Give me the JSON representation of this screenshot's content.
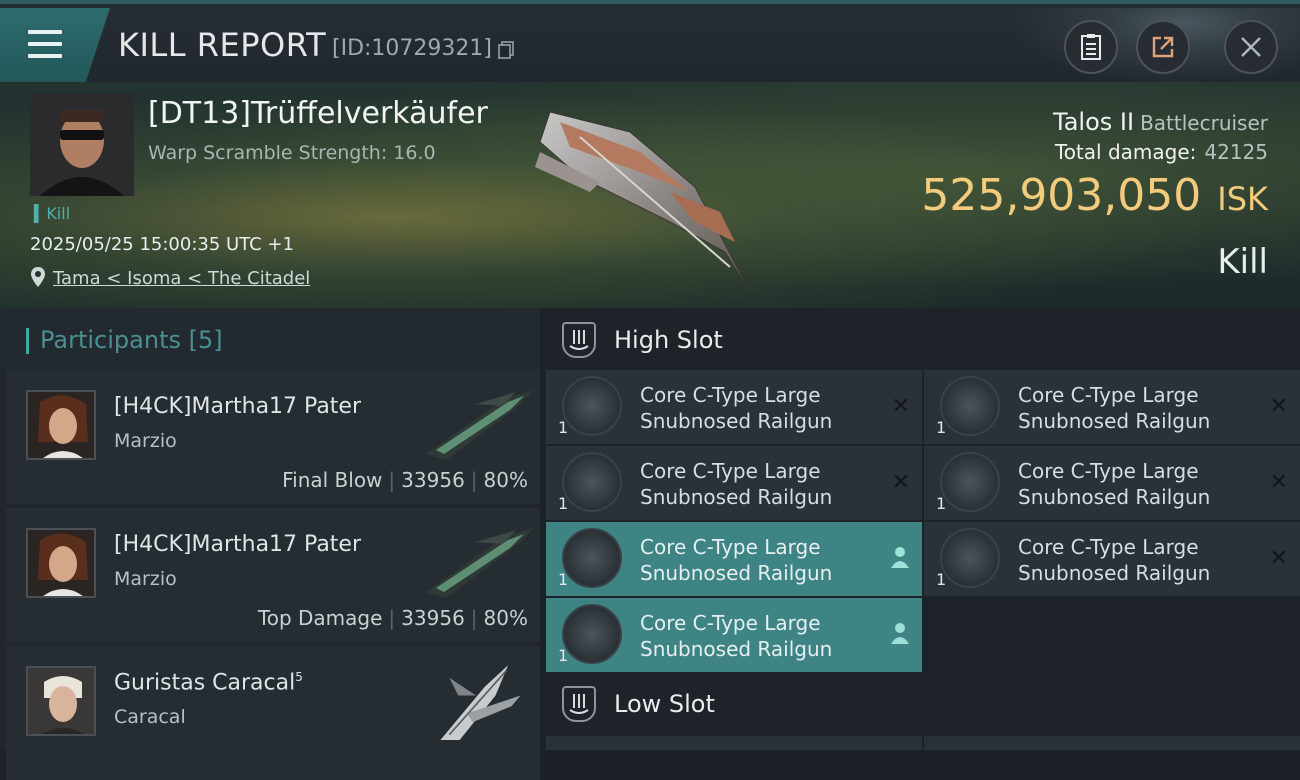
{
  "header": {
    "title": "KILL REPORT",
    "report_id": "[ID:10729321]"
  },
  "victim": {
    "name": "[DT13]Trüffelverkäufer",
    "sub_stat": "Warp Scramble Strength: 16.0",
    "tag": "Kill",
    "time": "2025/05/25 15:00:35 UTC +1",
    "location": "Tama < Isoma < The Citadel",
    "ship_name": "Talos II",
    "ship_class": "Battlecruiser",
    "total_damage_label": "Total damage:",
    "total_damage": "42125",
    "isk_value": "525,903,050",
    "isk_unit": "ISK",
    "result": "Kill"
  },
  "participants": {
    "label": "Participants",
    "count": "[5]",
    "items": [
      {
        "name": "[H4CK]Martha17 Pater",
        "sup": "",
        "corp": "Marzio",
        "role": "Final Blow",
        "damage": "33956",
        "percent": "80%"
      },
      {
        "name": "[H4CK]Martha17 Pater",
        "sup": "",
        "corp": "Marzio",
        "role": "Top Damage",
        "damage": "33956",
        "percent": "80%"
      },
      {
        "name": "Guristas Caracal",
        "sup": "5",
        "corp": "Caracal",
        "role": "",
        "damage": "",
        "percent": ""
      }
    ]
  },
  "fitting": {
    "high_slot_label": "High Slot",
    "low_slot_label": "Low Slot",
    "high_modules": [
      {
        "qty": "1",
        "name": "Core C-Type Large Snubnosed Railgun",
        "state": "destroyed"
      },
      {
        "qty": "1",
        "name": "Core C-Type Large Snubnosed Railgun",
        "state": "destroyed"
      },
      {
        "qty": "1",
        "name": "Core C-Type Large Snubnosed Railgun",
        "state": "destroyed"
      },
      {
        "qty": "1",
        "name": "Core C-Type Large Snubnosed Railgun",
        "state": "destroyed"
      },
      {
        "qty": "1",
        "name": "Core C-Type Large Snubnosed Railgun",
        "state": "dropped"
      },
      {
        "qty": "1",
        "name": "Core C-Type Large Snubnosed Railgun",
        "state": "destroyed"
      },
      {
        "qty": "1",
        "name": "Core C-Type Large Snubnosed Railgun",
        "state": "dropped"
      }
    ]
  },
  "colors": {
    "accent": "#3fa7a8",
    "isk": "#f2cc7c",
    "highlight_row": "#3e8484"
  }
}
